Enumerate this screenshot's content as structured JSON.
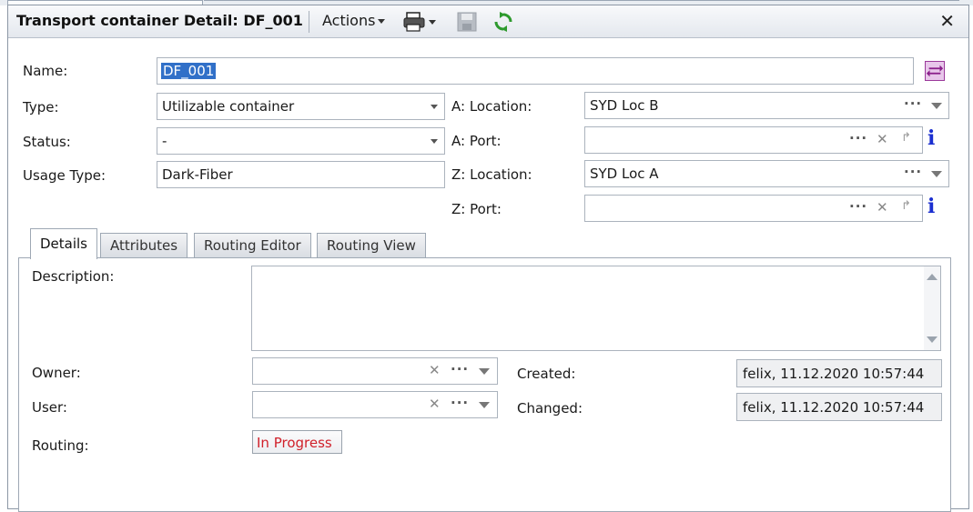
{
  "window": {
    "title": "Transport container Detail: DF_001",
    "actions_label": "Actions",
    "icons": [
      "print-icon",
      "save-icon",
      "refresh-icon",
      "close-icon"
    ]
  },
  "form": {
    "name_label": "Name:",
    "name_value": "DF_001",
    "type_label": "Type:",
    "type_value": "Utilizable container",
    "status_label": "Status:",
    "status_value": "-",
    "usage_type_label": "Usage Type:",
    "usage_type_value": "Dark-Fiber",
    "a_location_label": "A: Location:",
    "a_location_value": "SYD Loc B",
    "a_port_label": "A: Port:",
    "a_port_value": "",
    "z_location_label": "Z: Location:",
    "z_location_value": "SYD Loc A",
    "z_port_label": "Z: Port:",
    "z_port_value": "",
    "dots": "···",
    "clear": "✕",
    "info": "i"
  },
  "tabs": [
    {
      "label": "Details",
      "active": true
    },
    {
      "label": "Attributes",
      "active": false
    },
    {
      "label": "Routing Editor",
      "active": false
    },
    {
      "label": "Routing View",
      "active": false
    }
  ],
  "details": {
    "description_label": "Description:",
    "description_value": "",
    "owner_label": "Owner:",
    "owner_value": "",
    "user_label": "User:",
    "user_value": "",
    "created_label": "Created:",
    "created_value": "felix, 11.12.2020 10:57:44",
    "changed_label": "Changed:",
    "changed_value": "felix, 11.12.2020 10:57:44",
    "routing_label": "Routing:",
    "routing_status": "In Progress"
  },
  "colors": {
    "selection": "#3170c8",
    "info_icon": "#1b2fd0",
    "routing_status_text": "#d0202a",
    "swap_icon": "#9b3a9b"
  }
}
